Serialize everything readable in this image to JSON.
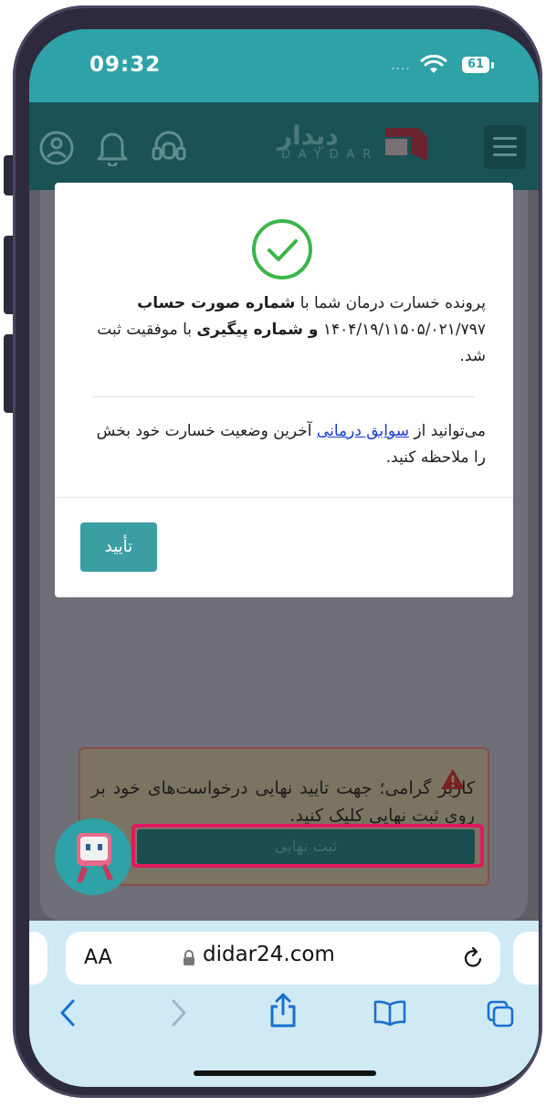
{
  "status_bar": {
    "time": "09:32",
    "battery": "61"
  },
  "site": {
    "logo_name": "دیدار",
    "logo_latin": "DAYDAR"
  },
  "modal": {
    "message_parts": [
      "پرونده خسارت درمان شما با ",
      "شماره صورت حساب",
      " ۱۴۰۴/۱۹/۱۱۵۰۵/۰۲۱/۷۹۷ ",
      "و شماره پیگیری",
      " با موفقیت ثبت شد."
    ],
    "info_prefix": "می‌توانید از",
    "info_link": "سوابق درمانی",
    "info_middle": "آخرین وضعیت خسارت خود",
    "info_suffix": "بخش",
    "info_end": "را ملاحظه کنید.",
    "confirm_label": "تأیید"
  },
  "page": {
    "warning_text": "کاربر گرامی؛ جهت تایید نهایی درخواست‌های خود بر روی ثبت نهایی کلیک کنید.",
    "final_submit_label": "ثبت نهایی"
  },
  "browser": {
    "text_size_label": "AA",
    "url": "didar24.com"
  },
  "colors": {
    "teal": "#2ea2a6",
    "confirm_button": "#3b9ea3",
    "success_green": "#3bb54a",
    "highlight": "#e0195e",
    "link": "#1a3bd1"
  }
}
